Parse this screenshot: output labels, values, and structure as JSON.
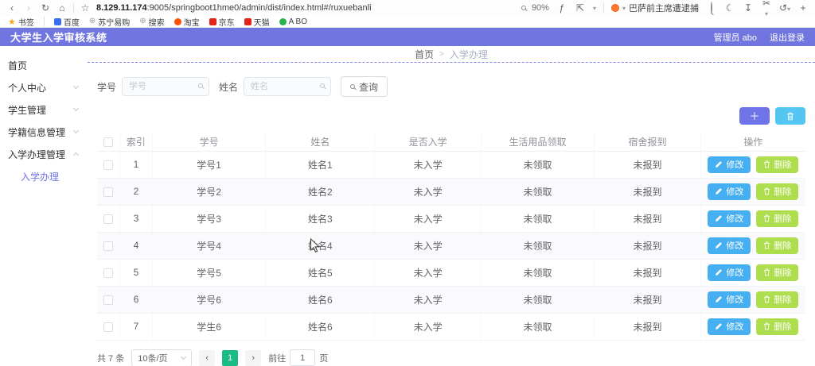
{
  "browser": {
    "url_host": "8.129.11.174",
    "url_path": ":9005/springboot1hme0/admin/dist/index.html#/ruxuebanli",
    "zoom_level": "90%",
    "news_title": "巴萨前主席遭逮捕",
    "bookmarks_label": "书签",
    "bookmarks": [
      {
        "label": "百度",
        "color": "#3a6ff2",
        "shape": "square"
      },
      {
        "label": "苏宁易购",
        "color": "#9aa0a6",
        "shape": "globe"
      },
      {
        "label": "搜索",
        "color": "#9aa0a6",
        "shape": "globe"
      },
      {
        "label": "淘宝",
        "color": "#ff5000",
        "shape": "circle"
      },
      {
        "label": "京东",
        "color": "#e1251b",
        "shape": "square"
      },
      {
        "label": "天猫",
        "color": "#e1251b",
        "shape": "square"
      },
      {
        "label": "A BO",
        "color": "#2bb24c",
        "shape": "circle"
      }
    ]
  },
  "header": {
    "title": "大学生入学审核系统",
    "user_label": "管理员 abo",
    "logout_label": "退出登录"
  },
  "sidebar": {
    "items": [
      {
        "label": "首页",
        "chevron": null
      },
      {
        "label": "个人中心",
        "chevron": "down"
      },
      {
        "label": "学生管理",
        "chevron": "down"
      },
      {
        "label": "学籍信息管理",
        "chevron": "down"
      },
      {
        "label": "入学办理管理",
        "chevron": "up",
        "children": [
          {
            "label": "入学办理",
            "active": true
          }
        ]
      }
    ]
  },
  "breadcrumb": {
    "home": "首页",
    "separator": ">",
    "current": "入学办理"
  },
  "filters": {
    "student_id_label": "学号",
    "student_id_placeholder": "学号",
    "name_label": "姓名",
    "name_placeholder": "姓名",
    "search_button": "查询"
  },
  "table": {
    "headers": [
      "索引",
      "学号",
      "姓名",
      "是否入学",
      "生活用品领取",
      "宿舍报到",
      "操作"
    ],
    "edit_label": "修改",
    "delete_label": "删除",
    "rows": [
      {
        "index": "1",
        "student_id": "学号1",
        "name": "姓名1",
        "enrolled": "未入学",
        "supplies": "未领取",
        "dorm": "未报到"
      },
      {
        "index": "2",
        "student_id": "学号2",
        "name": "姓名2",
        "enrolled": "未入学",
        "supplies": "未领取",
        "dorm": "未报到"
      },
      {
        "index": "3",
        "student_id": "学号3",
        "name": "姓名3",
        "enrolled": "未入学",
        "supplies": "未领取",
        "dorm": "未报到"
      },
      {
        "index": "4",
        "student_id": "学号4",
        "name": "姓名4",
        "enrolled": "未入学",
        "supplies": "未领取",
        "dorm": "未报到"
      },
      {
        "index": "5",
        "student_id": "学号5",
        "name": "姓名5",
        "enrolled": "未入学",
        "supplies": "未领取",
        "dorm": "未报到"
      },
      {
        "index": "6",
        "student_id": "学号6",
        "name": "姓名6",
        "enrolled": "未入学",
        "supplies": "未领取",
        "dorm": "未报到"
      },
      {
        "index": "7",
        "student_id": "学生6",
        "name": "姓名6",
        "enrolled": "未入学",
        "supplies": "未领取",
        "dorm": "未报到"
      }
    ]
  },
  "pagination": {
    "total_label": "共 7 条",
    "page_size_label": "10条/页",
    "current_page": "1",
    "goto_label": "前往",
    "goto_value": "1",
    "goto_unit": "页"
  },
  "colors": {
    "header_bg": "#7175e0",
    "accent_purple": "#6f74e8",
    "accent_cyan": "#55c6f2",
    "edit_blue": "#45aff2",
    "delete_green": "#aede4e",
    "pager_active": "#1abc84"
  }
}
